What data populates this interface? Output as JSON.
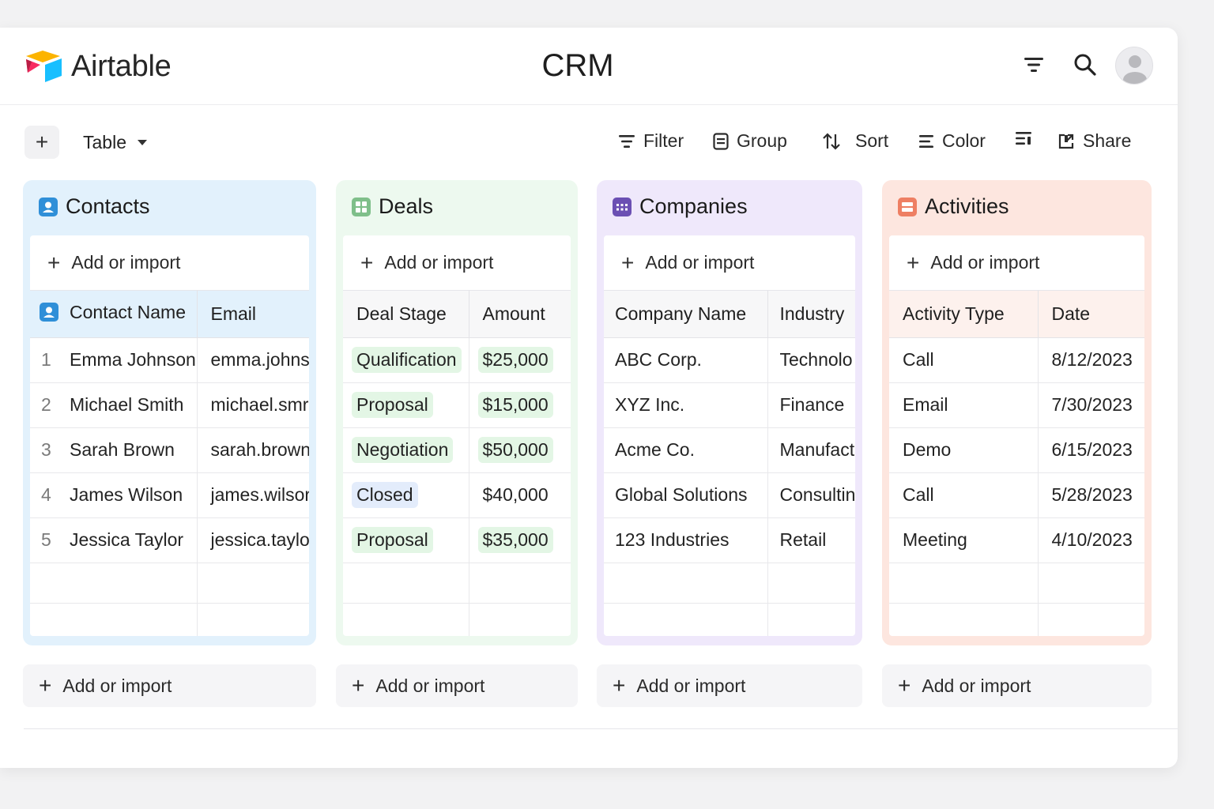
{
  "app": {
    "logo_text": "Airtable",
    "title": "CRM"
  },
  "toolbar": {
    "add_label": "+",
    "view_label": "Table",
    "filter_label": "Filter",
    "group_label": "Group",
    "sort_label": "Sort",
    "color_label": "Color",
    "share_label": "Share"
  },
  "add_or_import": "Add or import",
  "tables": {
    "contacts": {
      "name": "Contacts",
      "accent": "#2f8fd8",
      "columns": [
        "Contact Name",
        "Email"
      ],
      "rows": [
        {
          "num": "1",
          "name": "Emma Johnson",
          "email": "emma.johns"
        },
        {
          "num": "2",
          "name": "Michael Smith",
          "email": "michael.smr"
        },
        {
          "num": "3",
          "name": "Sarah Brown",
          "email": "sarah.brown"
        },
        {
          "num": "4",
          "name": "James Wilson",
          "email": "james.wilsor"
        },
        {
          "num": "5",
          "name": "Jessica Taylor",
          "email": "jessica.taylo"
        }
      ]
    },
    "deals": {
      "name": "Deals",
      "accent": "#7fbf8a",
      "columns": [
        "Deal Stage",
        "Amount"
      ],
      "rows": [
        {
          "stage": "Qualification",
          "amount": "$25,000",
          "stage_color": "#e3f6e5",
          "amount_color": "#e3f6e5"
        },
        {
          "stage": "Proposal",
          "amount": "$15,000",
          "stage_color": "#e3f6e5",
          "amount_color": "#e3f6e5"
        },
        {
          "stage": "Negotiation",
          "amount": "$50,000",
          "stage_color": "#e3f6e5",
          "amount_color": "#e3f6e5"
        },
        {
          "stage": "Closed",
          "amount": "$40,000",
          "stage_color": "#e3ecfb",
          "amount_color": "#ffffff"
        },
        {
          "stage": "Proposal",
          "amount": "$35,000",
          "stage_color": "#e3f6e5",
          "amount_color": "#e3f6e5"
        }
      ]
    },
    "companies": {
      "name": "Companies",
      "accent": "#6b4fb3",
      "columns": [
        "Company Name",
        "Industry"
      ],
      "rows": [
        {
          "name": "ABC Corp.",
          "industry": "Technolo"
        },
        {
          "name": "XYZ Inc.",
          "industry": "Finance"
        },
        {
          "name": "Acme Co.",
          "industry": "Manufact"
        },
        {
          "name": "Global Solutions",
          "industry": "Consultin"
        },
        {
          "name": "123 Industries",
          "industry": "Retail"
        }
      ]
    },
    "activities": {
      "name": "Activities",
      "accent": "#ee7f63",
      "columns": [
        "Activity Type",
        "Date"
      ],
      "rows": [
        {
          "type": "Call",
          "date": "8/12/2023"
        },
        {
          "type": "Email",
          "date": "7/30/2023"
        },
        {
          "type": "Demo",
          "date": "6/15/2023"
        },
        {
          "type": "Call",
          "date": "5/28/2023"
        },
        {
          "type": "Meeting",
          "date": "4/10/2023"
        }
      ]
    }
  },
  "icons": {
    "header": [
      "filter-icon",
      "search-icon",
      "user-avatar"
    ],
    "toolbar": [
      "filter-icon",
      "group-icon",
      "sort-icon",
      "color-icon",
      "row-height-icon",
      "share-icon"
    ]
  },
  "colors": {
    "contacts_bg": "#e2f1fc",
    "deals_bg": "#edf9ef",
    "companies_bg": "#efe8fb",
    "activities_bg": "#fde6df"
  }
}
